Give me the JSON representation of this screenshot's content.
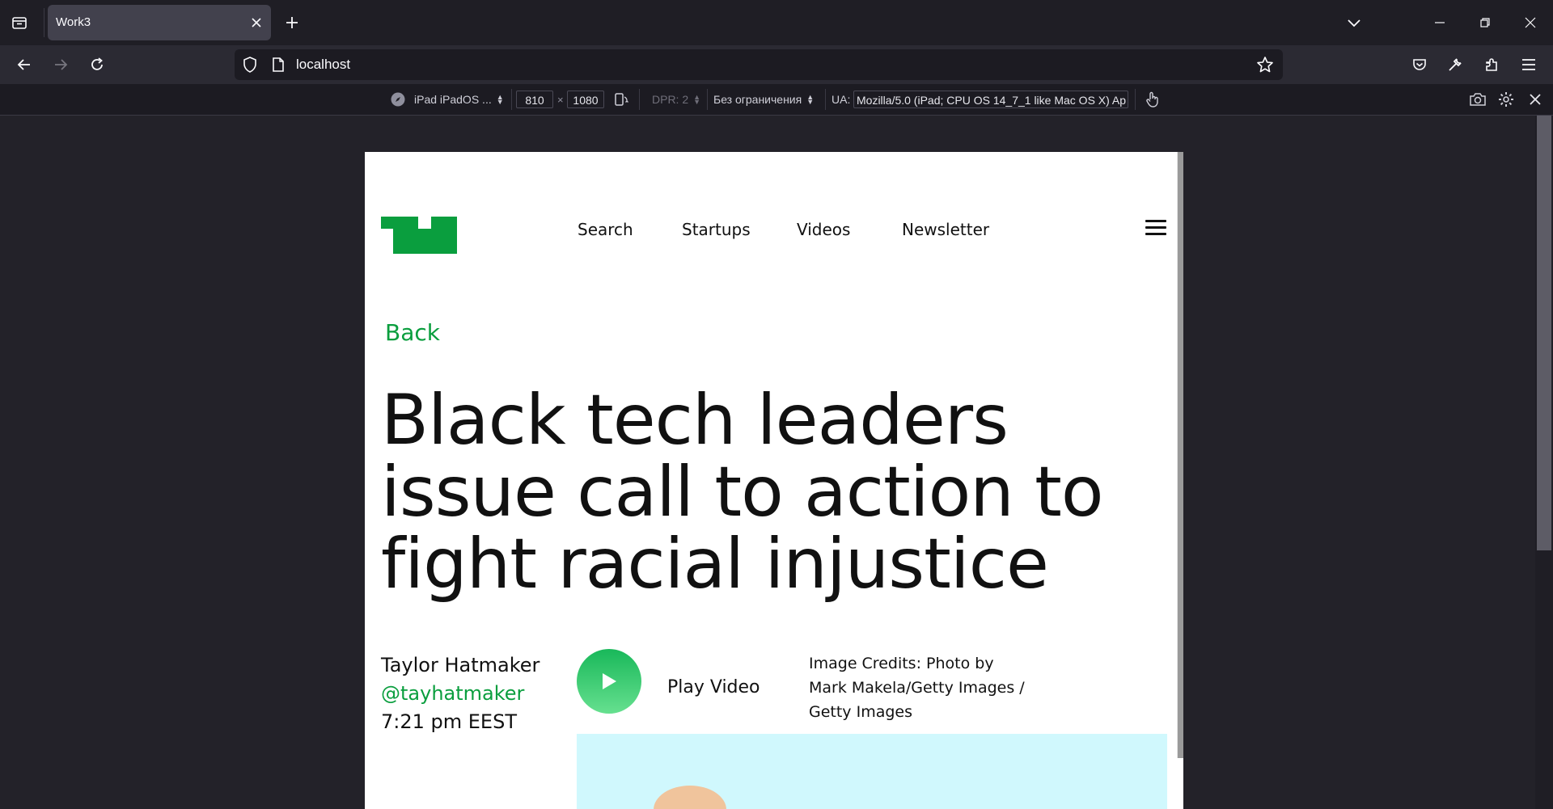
{
  "browser": {
    "tab_title": "Work3",
    "url": "localhost"
  },
  "rdm": {
    "device": "iPad iPadOS ...",
    "width": "810",
    "times": "×",
    "height": "1080",
    "dpr": "DPR: 2",
    "throttling": "Без ограничения",
    "ua_label": "UA:",
    "ua_value": "Mozilla/5.0 (iPad; CPU OS 14_7_1 like Mac OS X) Ap"
  },
  "site": {
    "nav": [
      "Search",
      "Startups",
      "Videos",
      "Newsletter"
    ],
    "back": "Back",
    "headline": "Black tech leaders issue call to action to fight racial injustice",
    "author": "Taylor Hatmaker",
    "handle": "@tayhatmaker",
    "time": "7:21 pm EEST",
    "play_video": "Play Video",
    "credits": "Image Credits: Photo by Mark Makela/Getty Images / Getty Images"
  },
  "colors": {
    "brand_green": "#0a9e3e",
    "hero_bg": "#d0f8fd"
  }
}
